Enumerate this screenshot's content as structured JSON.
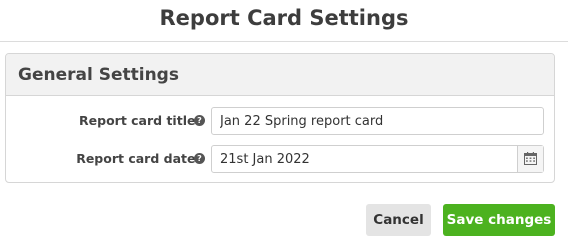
{
  "page": {
    "title": "Report Card Settings"
  },
  "panel": {
    "title": "General Settings",
    "fields": {
      "report_title": {
        "label": "Report card title*",
        "value": "Jan 22 Spring report card",
        "help_icon": "question-circle-icon"
      },
      "report_date": {
        "label": "Report card date*",
        "value": "21st Jan 2022",
        "help_icon": "question-circle-icon",
        "picker_icon": "calendar-icon"
      }
    }
  },
  "actions": {
    "cancel_label": "Cancel",
    "save_label": "Save changes"
  },
  "colors": {
    "save_button": "#4cb21f",
    "cancel_button": "#e4e4e4",
    "panel_header": "#f2f2f2"
  }
}
